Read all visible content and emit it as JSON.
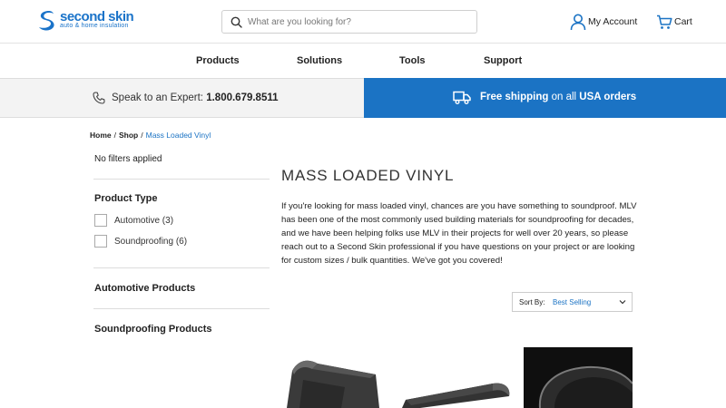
{
  "header": {
    "logo_text": "second skin",
    "logo_subtext": "auto & home insulation",
    "search": {
      "placeholder": "What are you looking for?",
      "value": ""
    },
    "account_label": "My Account",
    "cart_label": "Cart"
  },
  "nav": {
    "items": [
      {
        "label": "Products"
      },
      {
        "label": "Solutions"
      },
      {
        "label": "Tools"
      },
      {
        "label": "Support"
      }
    ]
  },
  "promo": {
    "expert_text": "Speak to an Expert: ",
    "expert_phone": "1.800.679.8511",
    "shipping_bold": "Free shipping",
    "shipping_mid": " on all ",
    "shipping_bold2": "USA orders"
  },
  "breadcrumb": {
    "items": [
      "Home",
      "Shop"
    ],
    "current": "Mass Loaded Vinyl",
    "separator": "/"
  },
  "sidebar": {
    "no_filters": "No filters applied",
    "product_type_heading": "Product Type",
    "filters": [
      {
        "label": "Automotive (3)",
        "checked": false
      },
      {
        "label": "Soundproofing (6)",
        "checked": false
      }
    ],
    "automotive_heading": "Automotive Products",
    "soundproofing_heading": "Soundproofing Products"
  },
  "main": {
    "title": "MASS LOADED VINYL",
    "description": "If you're looking for mass loaded vinyl, chances are you have something to soundproof. MLV has been one of the most commonly used building materials for soundproofing for decades, and we have been helping folks use MLV in their projects for well over 20 years, so please reach out to a Second Skin professional if you have questions on your project or are looking for custom sizes / bulk quantities. We've got you covered!",
    "sort_label": "Sort By:",
    "sort_value": "Best Selling"
  },
  "colors": {
    "brand_blue": "#1b73c4",
    "promo_gray": "#f3f3f3"
  },
  "icons": [
    "logo-mark-icon",
    "search-icon",
    "user-icon",
    "cart-icon",
    "phone-icon",
    "truck-icon",
    "chevron-down-icon"
  ]
}
